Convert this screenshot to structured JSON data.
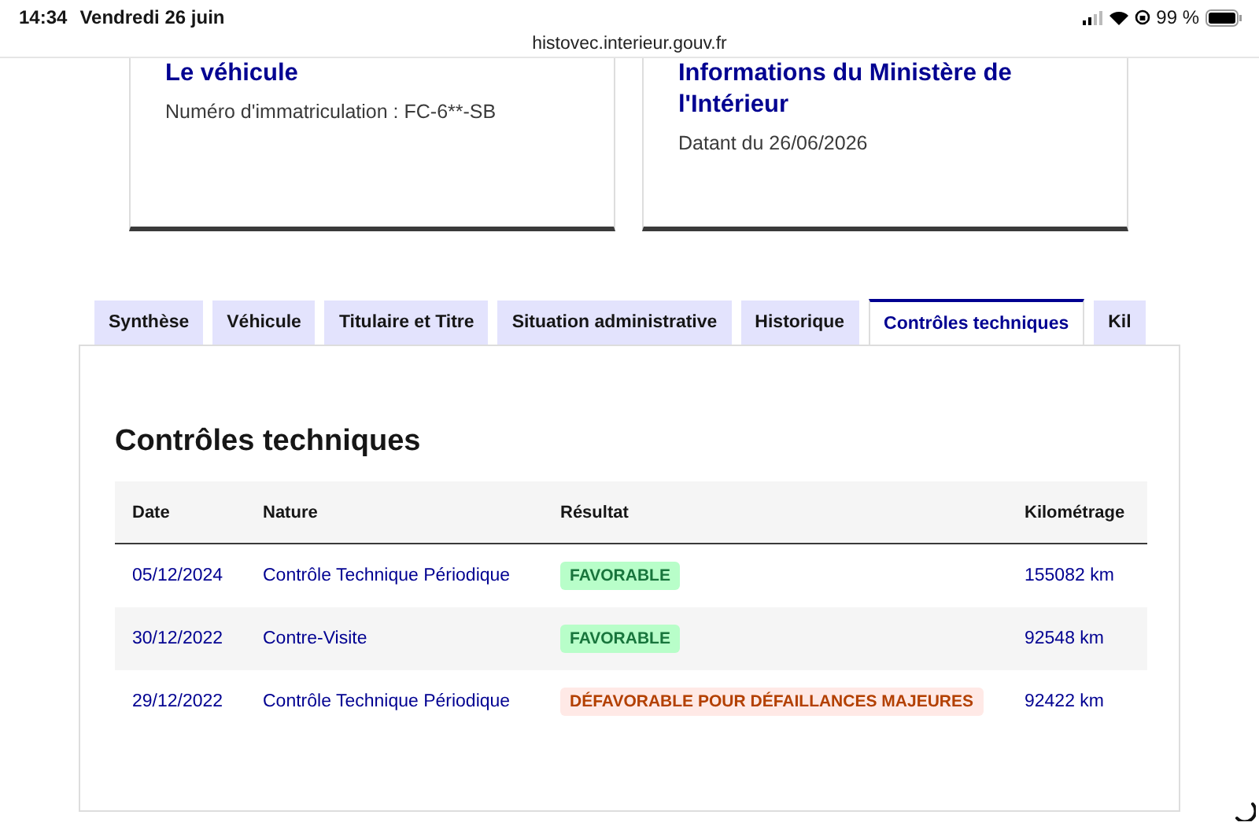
{
  "status_bar": {
    "time": "14:34",
    "date": "Vendredi 26 juin",
    "battery": "99 %"
  },
  "url": "histovec.interieur.gouv.fr",
  "cards": [
    {
      "title": "Le véhicule",
      "text": "Numéro d'immatriculation : FC-6**-SB"
    },
    {
      "title": "Informations du Ministère de l'Intérieur",
      "text": "Datant du 26/06/2026"
    }
  ],
  "tabs": [
    {
      "label": "Synthèse",
      "selected": false
    },
    {
      "label": "Véhicule",
      "selected": false
    },
    {
      "label": "Titulaire et Titre",
      "selected": false
    },
    {
      "label": "Situation administrative",
      "selected": false
    },
    {
      "label": "Historique",
      "selected": false
    },
    {
      "label": "Contrôles techniques",
      "selected": true
    },
    {
      "label": "Kil",
      "selected": false
    }
  ],
  "section_title": "Contrôles techniques",
  "table": {
    "columns": [
      "Date",
      "Nature",
      "Résultat",
      "Kilométrage"
    ],
    "rows": [
      {
        "date": "05/12/2024",
        "nature": "Contrôle Technique Périodique",
        "result": {
          "label": "FAVORABLE",
          "kind": "success"
        },
        "mileage": "155082 km"
      },
      {
        "date": "30/12/2022",
        "nature": "Contre-Visite",
        "result": {
          "label": "FAVORABLE",
          "kind": "success"
        },
        "mileage": "92548 km"
      },
      {
        "date": "29/12/2022",
        "nature": "Contrôle Technique Périodique",
        "result": {
          "label": "DÉFAVORABLE POUR DÉFAILLANCES MAJEURES",
          "kind": "error"
        },
        "mileage": "92422 km"
      }
    ]
  }
}
